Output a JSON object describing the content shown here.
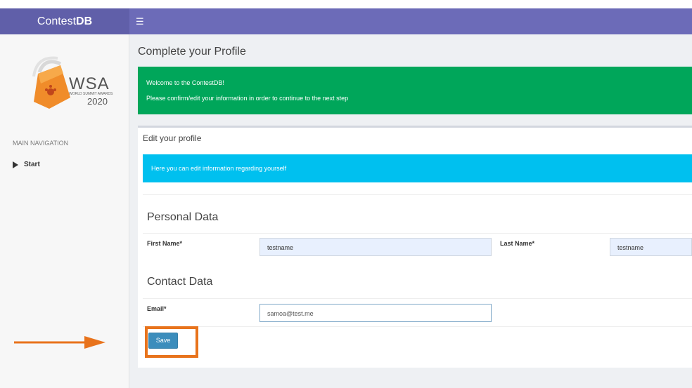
{
  "app": {
    "brand_prefix": "Contest",
    "brand_suffix": "DB",
    "menu_icon": "hamburger-icon",
    "colors": {
      "navbar": "#6c6bb8",
      "success": "#00a65a",
      "info": "#00c0ef",
      "primary": "#3c8dbc",
      "highlight": "#e8731c"
    }
  },
  "sidebar": {
    "logo": {
      "text": "WSA",
      "subtext": "WORLD SUMMIT AWARDS",
      "year": "2020"
    },
    "nav_header": "MAIN NAVIGATION",
    "items": [
      {
        "label": "Start",
        "icon": "play-triangle-icon"
      }
    ]
  },
  "main": {
    "page_title": "Complete your Profile",
    "welcome_alert": {
      "line1": "Welcome to the ContestDB!",
      "line2": "Please confirm/edit your information in order to continue to the next step"
    },
    "profile_box": {
      "title": "Edit your profile",
      "info_alert": "Here you can edit information regarding yourself",
      "personal_section": "Personal Data",
      "first_name_label": "First Name*",
      "first_name_value": "testname",
      "last_name_label": "Last Name*",
      "last_name_value": "testname",
      "contact_section": "Contact Data",
      "email_label": "Email*",
      "email_value": "samoa@test.me",
      "save_label": "Save"
    }
  }
}
